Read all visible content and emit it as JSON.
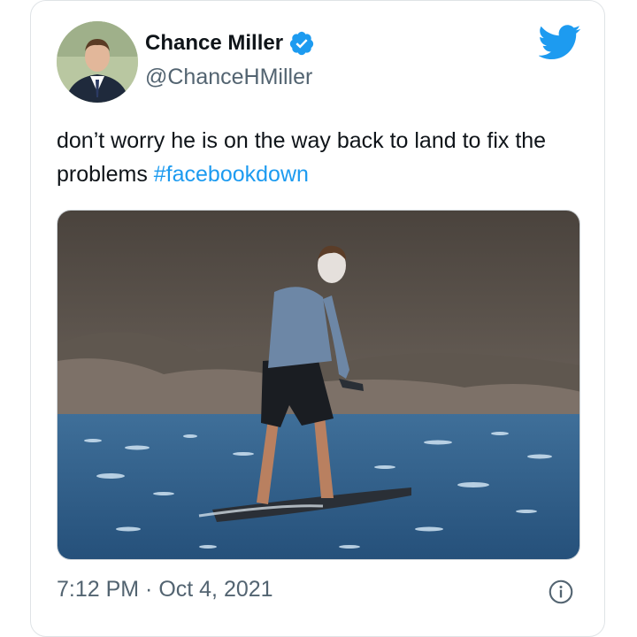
{
  "tweet": {
    "author_name": "Chance Miller",
    "author_handle": "@ChanceHMiller",
    "text": "don’t worry he is on the way back to land to fix the problems ",
    "hashtag": "#facebookdown",
    "timestamp": "7:12 PM · Oct 4, 2021"
  },
  "icons": {
    "brand": "twitter-bird-icon",
    "verified": "verified-badge-icon",
    "info": "info-icon"
  },
  "colors": {
    "brand_blue": "#1d9bf0",
    "text_primary": "#0f1419",
    "text_secondary": "#536471"
  }
}
